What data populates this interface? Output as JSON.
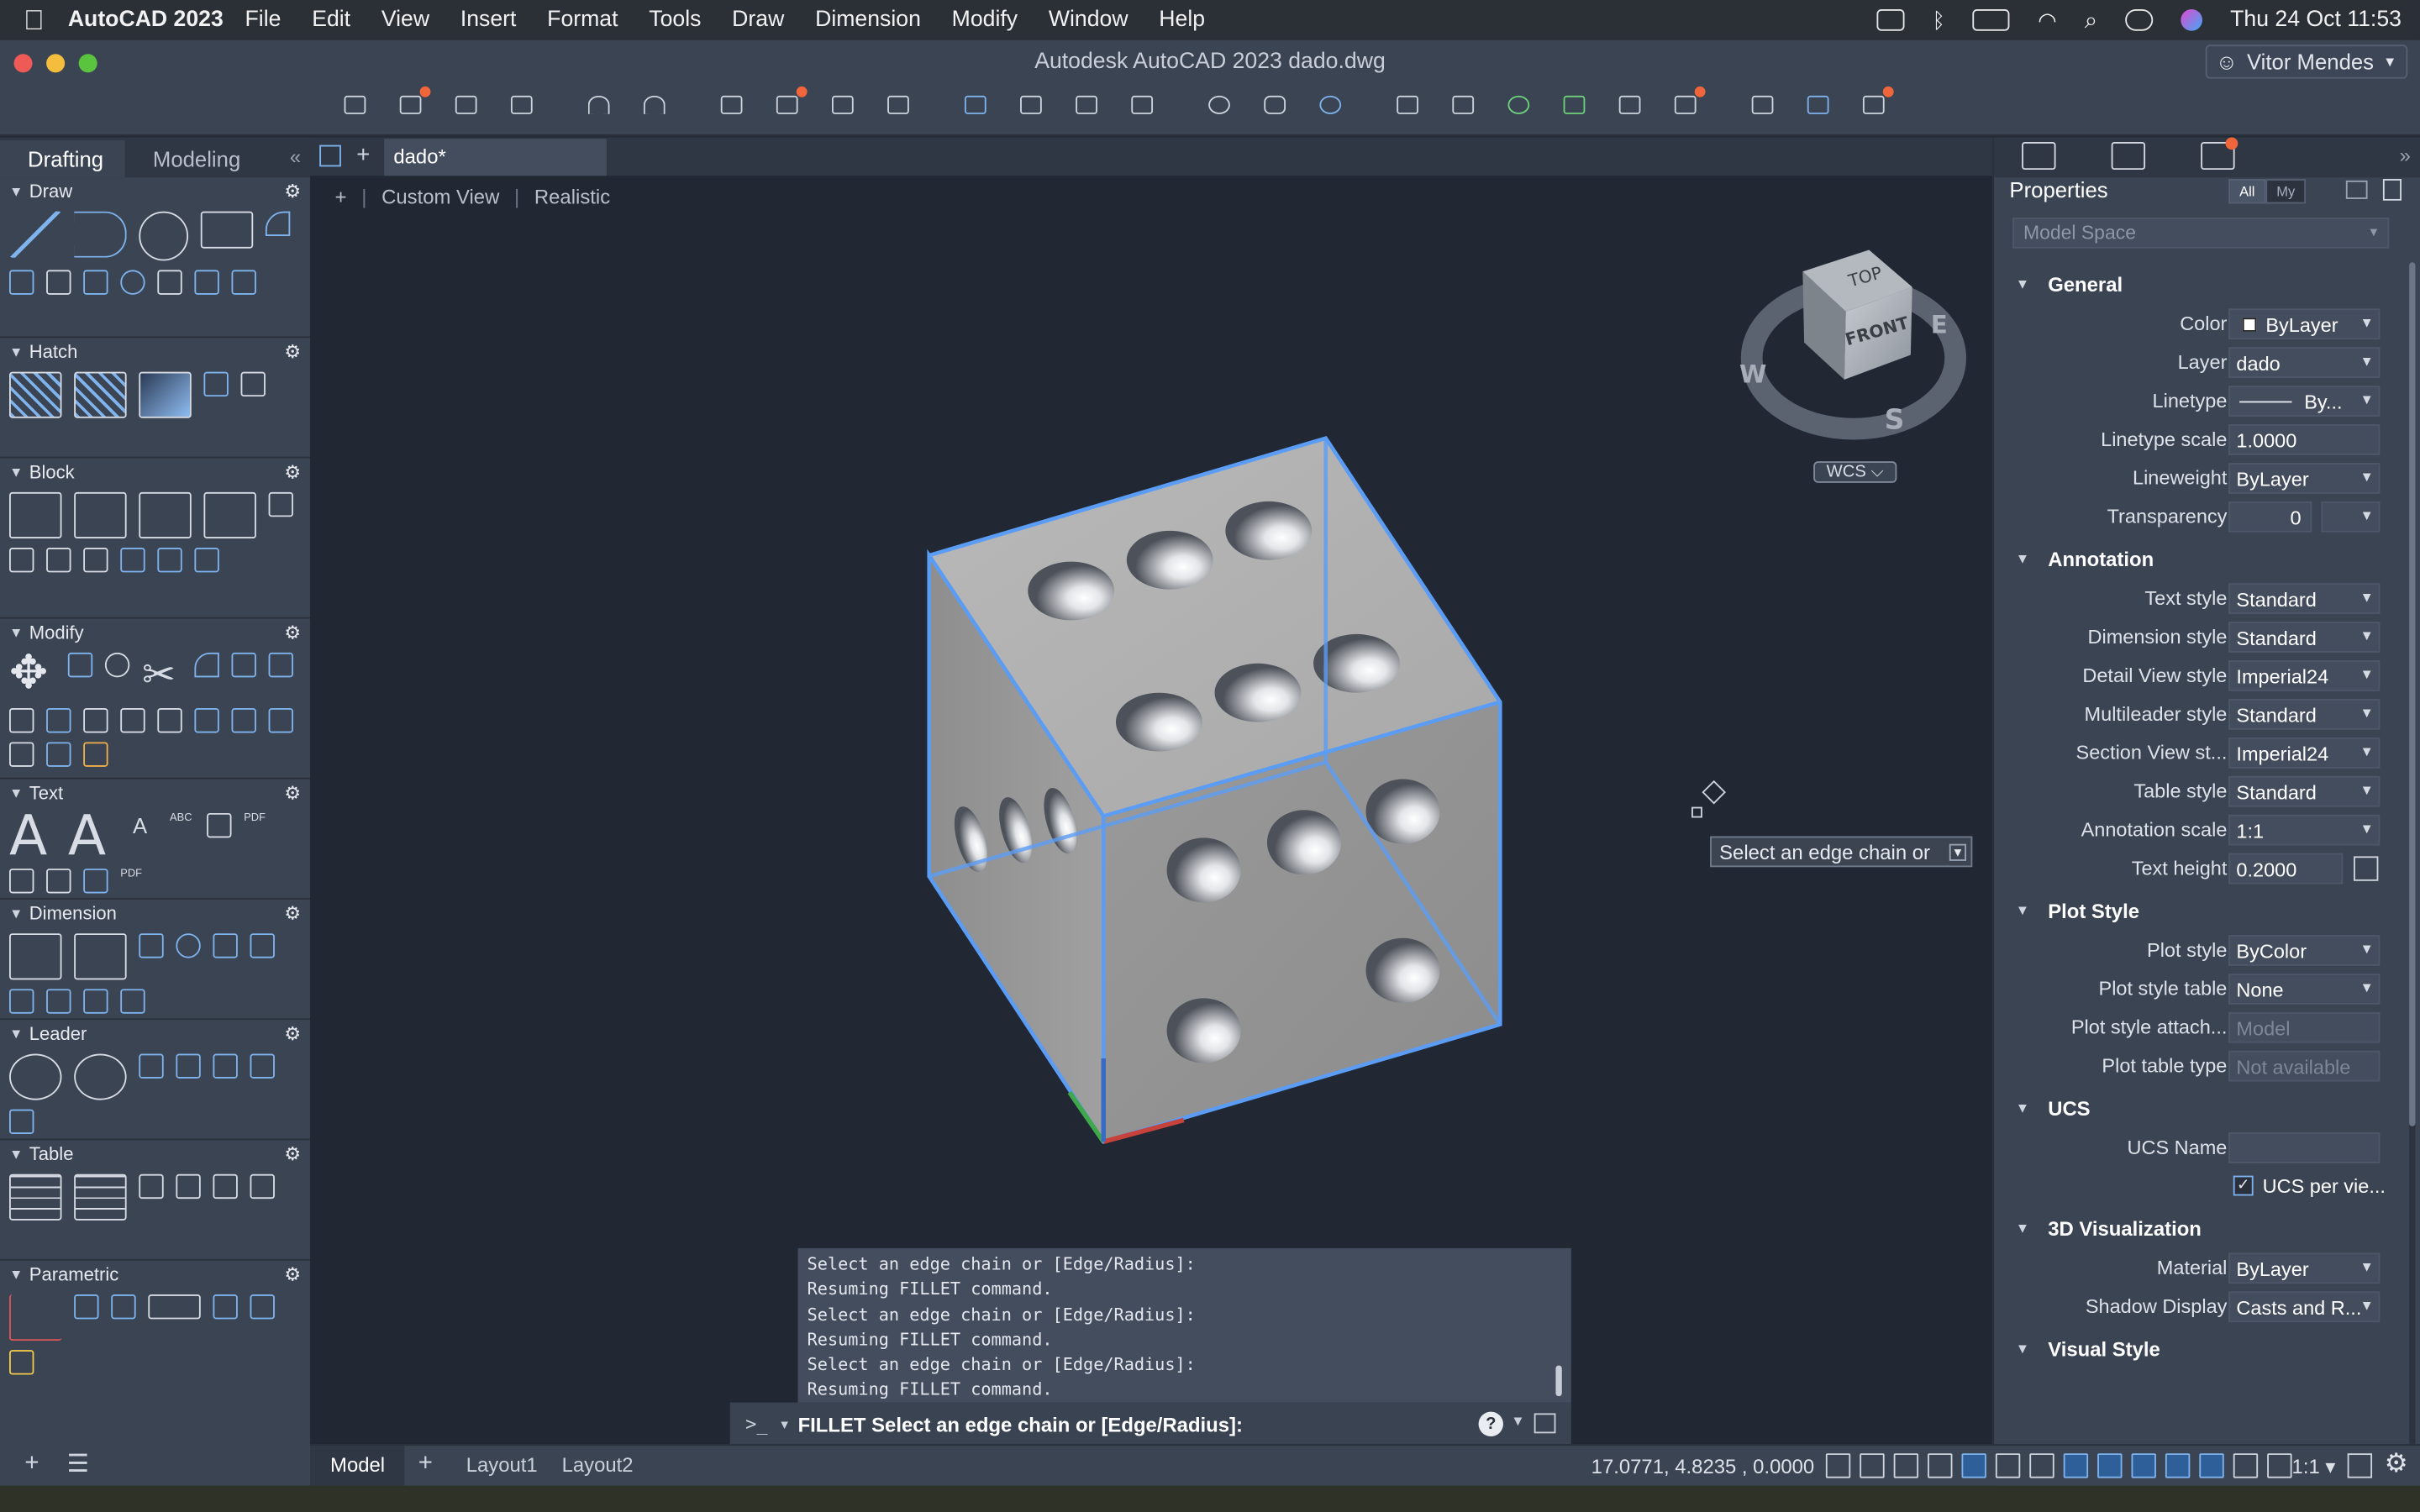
{
  "menubar": {
    "app": "AutoCAD 2023",
    "items": [
      "File",
      "Edit",
      "View",
      "Insert",
      "Format",
      "Tools",
      "Draw",
      "Dimension",
      "Modify",
      "Window",
      "Help"
    ],
    "clock": "Thu 24 Oct  11:53"
  },
  "window": {
    "title": "Autodesk AutoCAD 2023    dado.dwg",
    "user": "Vitor Mendes"
  },
  "palette": {
    "tabs": [
      "Drafting",
      "Modeling"
    ],
    "sections": [
      "Draw",
      "Hatch",
      "Block",
      "Modify",
      "Text",
      "Dimension",
      "Leader",
      "Table",
      "Parametric"
    ]
  },
  "file_tab": "dado*",
  "viewport": {
    "view": "Custom View",
    "style": "Realistic",
    "viewcube": {
      "top": "TOP",
      "front": "FRONT",
      "compass": {
        "w": "W",
        "e": "E",
        "s": "S"
      }
    },
    "wcs": "WCS",
    "tooltip": "Select an edge chain or"
  },
  "command": {
    "history": [
      "Select an edge chain or [Edge/Radius]:",
      "Resuming FILLET command.",
      "Select an edge chain or [Edge/Radius]:",
      "Resuming FILLET command.",
      "Select an edge chain or [Edge/Radius]:",
      "Resuming FILLET command."
    ],
    "prompt_symbol": ">_",
    "current": "FILLET Select an edge chain or [Edge/Radius]:"
  },
  "properties": {
    "title": "Properties",
    "filter": [
      "All",
      "My"
    ],
    "selection": "Model Space",
    "groups": {
      "general": "General",
      "annotation": "Annotation",
      "plot_style": "Plot Style",
      "ucs": "UCS",
      "viz3d": "3D Visualization",
      "visual_style": "Visual Style"
    },
    "general": [
      {
        "label": "Color",
        "value": "ByLayer"
      },
      {
        "label": "Layer",
        "value": "dado"
      },
      {
        "label": "Linetype",
        "value": "By..."
      },
      {
        "label": "Linetype scale",
        "value": "1.0000"
      },
      {
        "label": "Lineweight",
        "value": "ByLayer"
      },
      {
        "label": "Transparency",
        "value": "0"
      }
    ],
    "annotation": [
      {
        "label": "Text style",
        "value": "Standard"
      },
      {
        "label": "Dimension style",
        "value": "Standard"
      },
      {
        "label": "Detail View style",
        "value": "Imperial24"
      },
      {
        "label": "Multileader style",
        "value": "Standard"
      },
      {
        "label": "Section View st...",
        "value": "Imperial24"
      },
      {
        "label": "Table style",
        "value": "Standard"
      },
      {
        "label": "Annotation scale",
        "value": "1:1"
      },
      {
        "label": "Text height",
        "value": "0.2000"
      }
    ],
    "plot_style": [
      {
        "label": "Plot style",
        "value": "ByColor"
      },
      {
        "label": "Plot style table",
        "value": "None"
      },
      {
        "label": "Plot style attach...",
        "value": "Model"
      },
      {
        "label": "Plot table type",
        "value": "Not available"
      }
    ],
    "ucs": [
      {
        "label": "UCS Name",
        "value": ""
      },
      {
        "label": "UCS per vie...",
        "value": "checked"
      }
    ],
    "viz3d": [
      {
        "label": "Material",
        "value": "ByLayer"
      },
      {
        "label": "Shadow Display",
        "value": "Casts and R..."
      }
    ]
  },
  "status": {
    "layouts": [
      "Model",
      "Layout1",
      "Layout2"
    ],
    "coords": "17.0771, 4.8235 , 0.0000",
    "scale": "1:1"
  },
  "colors": {
    "accent": "#5b9cf5",
    "panel": "#3b4453",
    "viewport": "#212834",
    "notification": "#f0653a"
  }
}
